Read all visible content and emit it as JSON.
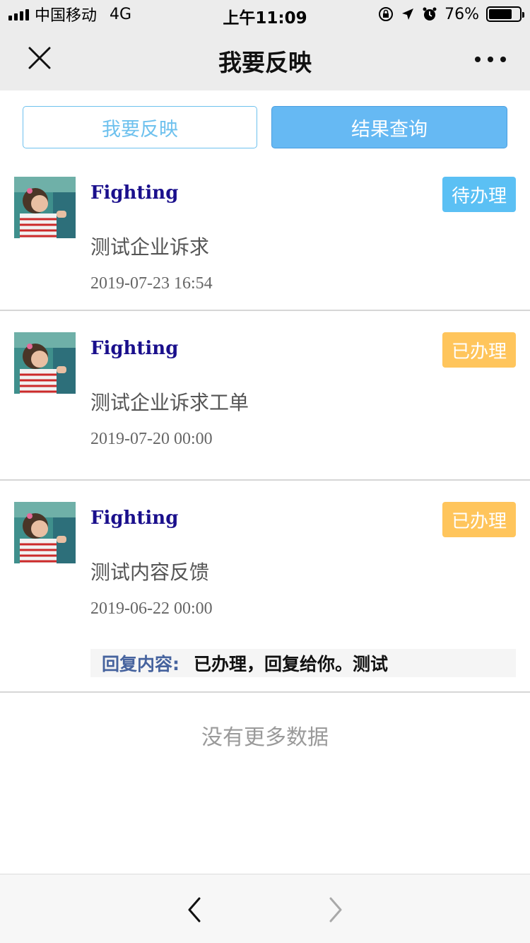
{
  "status_bar": {
    "carrier": "中国移动",
    "network": "4G",
    "time": "上午11:09",
    "battery": "76%",
    "battery_level": 0.76,
    "icons": [
      "orientation-lock-icon",
      "location-icon",
      "alarm-icon"
    ]
  },
  "nav": {
    "title": "我要反映",
    "close_icon": "close-icon",
    "more_icon": "more-icon"
  },
  "tabs": [
    {
      "label": "我要反映",
      "active": false
    },
    {
      "label": "结果查询",
      "active": true
    }
  ],
  "items": [
    {
      "name": "Fighting",
      "status": "待办理",
      "status_color": "#5bc0f4",
      "title": "测试企业诉求",
      "date": "2019-07-23 16:54"
    },
    {
      "name": "Fighting",
      "status": "已办理",
      "status_color": "#ffc55c",
      "title": "测试企业诉求工单",
      "date": "2019-07-20 00:00"
    },
    {
      "name": "Fighting",
      "status": "已办理",
      "status_color": "#ffc55c",
      "title": "测试内容反馈",
      "date": "2019-06-22 00:00",
      "reply_label": "回复内容:",
      "reply_text": "已办理，回复给你。测试"
    }
  ],
  "no_more": "没有更多数据",
  "colors": {
    "accent": "#66b9f3",
    "pending": "#5bc0f4",
    "done": "#ffc55c",
    "name": "#1a0f8c"
  },
  "bottom_bar": {
    "back_icon": "chevron-left-icon",
    "forward_icon": "chevron-right-icon"
  }
}
